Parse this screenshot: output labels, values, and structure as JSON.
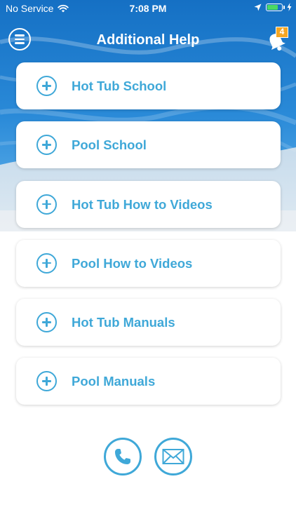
{
  "status_bar": {
    "carrier": "No Service",
    "time": "7:08 PM",
    "battery_color": "#4cd964",
    "battery_level": 0.75,
    "icons": [
      "wifi-icon",
      "location-arrow-icon",
      "battery-icon",
      "charging-bolt-icon"
    ]
  },
  "header": {
    "title": "Additional Help",
    "menu_icon": "hamburger-circle-icon",
    "notification_icon": "bell-icon",
    "notification_count": "4",
    "badge_color": "#f5a623"
  },
  "menu": {
    "accent_color": "#3fa8d8",
    "icon": "plus-circle-icon",
    "items": [
      {
        "label": "Hot Tub School"
      },
      {
        "label": "Pool School"
      },
      {
        "label": "Hot Tub How to Videos"
      },
      {
        "label": "Pool How to Videos"
      },
      {
        "label": "Hot Tub Manuals"
      },
      {
        "label": "Pool Manuals"
      }
    ]
  },
  "contact": {
    "phone_icon": "phone-icon",
    "email_icon": "envelope-icon"
  }
}
